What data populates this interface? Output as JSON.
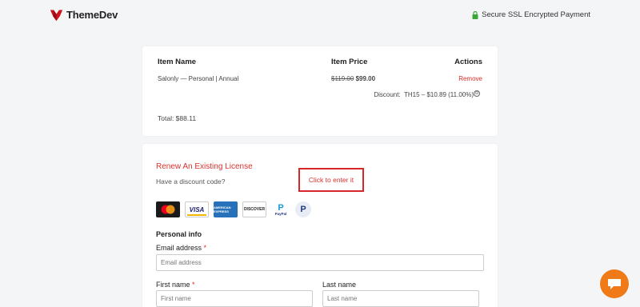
{
  "brand": {
    "name": "ThemeDev",
    "color": "#d0121b"
  },
  "header": {
    "ssl_text": "Secure SSL Encrypted Payment",
    "lock_color": "#3aa635"
  },
  "cart": {
    "headers": {
      "item_name": "Item Name",
      "item_price": "Item Price",
      "actions": "Actions"
    },
    "item": {
      "name": "Salonly — Personal | Annual",
      "original_price": "$119.00",
      "price": "$99.00",
      "remove_label": "Remove"
    },
    "discount": {
      "label": "Discount:",
      "value": "TH15 – $10.89 (11.00%)"
    },
    "total": "Total: $88.11"
  },
  "checkout": {
    "renew_link": "Renew An Existing License",
    "discount_prompt": "Have a discount code?",
    "discount_link": "Click to enter it",
    "payment_methods": [
      "mastercard",
      "visa",
      "american-express",
      "discover",
      "paypal",
      "paypal-p"
    ],
    "visa_text": "VISA",
    "amex_text": "AMERICAN EXPRESS",
    "discover_text": "DISCOVER",
    "paypal_text": "PayPal",
    "paypal_p": "P",
    "section_title": "Personal info",
    "email": {
      "label": "Email address",
      "placeholder": "Email address"
    },
    "first_name": {
      "label": "First name",
      "placeholder": "First name"
    },
    "last_name": {
      "label": "Last name",
      "placeholder": "Last name"
    },
    "required_mark": "*"
  },
  "chat": {
    "icon": "chat-bubble-icon",
    "color": "#f07a18"
  }
}
